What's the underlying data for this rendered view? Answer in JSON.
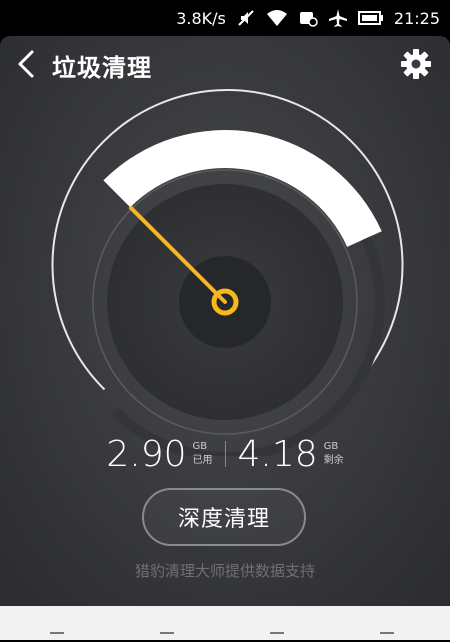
{
  "status_bar": {
    "speed": "3.8K/s",
    "time": "21:25",
    "icons": [
      "mute-icon",
      "wifi-icon",
      "notification-icon",
      "airplane-icon",
      "battery-icon"
    ]
  },
  "header": {
    "title": "垃圾清理",
    "back_icon": "chevron-left-icon",
    "settings_icon": "gear-icon"
  },
  "gauge": {
    "used_fraction": 0.41,
    "accent": "#f6b81a"
  },
  "storage": {
    "used_value": "2.90",
    "used_unit": "GB",
    "used_label": "已用",
    "free_value": "4.18",
    "free_unit": "GB",
    "free_label": "剩余"
  },
  "actions": {
    "deep_clean_label": "深度清理"
  },
  "footer": {
    "credit": "猎豹清理大师提供数据支持"
  },
  "colors": {
    "panel_bg": "#3a3b3f",
    "accent": "#f6b81a",
    "text": "#ffffff"
  }
}
